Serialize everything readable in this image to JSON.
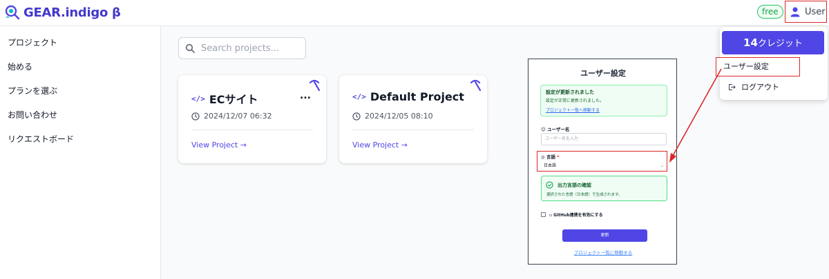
{
  "app": {
    "title": "GEAR.indigo β",
    "plan_badge": "free",
    "user_label": "User"
  },
  "sidebar": {
    "items": [
      {
        "label": "プロジェクト"
      },
      {
        "label": "始める"
      },
      {
        "label": "プランを選ぶ"
      },
      {
        "label": "お問い合わせ"
      },
      {
        "label": "リクエストボード"
      }
    ]
  },
  "search": {
    "placeholder": "Search projects..."
  },
  "projects": [
    {
      "name": "ECサイト",
      "date": "2024/12/07 06:32",
      "link": "View Project →",
      "more": "..."
    },
    {
      "name": "Default Project",
      "date": "2024/12/05 08:10",
      "link": "View Project →"
    }
  ],
  "user_menu": {
    "credits_number": "14",
    "credits_unit": "クレジット",
    "settings": "ユーザー設定",
    "logout": "ログアウト"
  },
  "settings_panel": {
    "title": "ユーザー設定",
    "success_title": "設定が更新されました",
    "success_body": "設定が正常に更新されました。",
    "success_link": "プロジェクト一覧へ移動する",
    "username_label": "ユーザー名",
    "username_placeholder": "ユーザー名を入力",
    "language_label": "言語",
    "language_required": "*",
    "language_value": "日本語",
    "confirm_title": "出力言語の確認",
    "confirm_body": "選択された言語（日本語）で生成されます。",
    "github_label": "GitHub連携を有効にする",
    "update_button": "更新",
    "footer_link": "プロジェクト一覧に移動する"
  },
  "colors": {
    "accent": "#4f46e5",
    "highlight": "#dc2626",
    "success": "#22c55e"
  }
}
